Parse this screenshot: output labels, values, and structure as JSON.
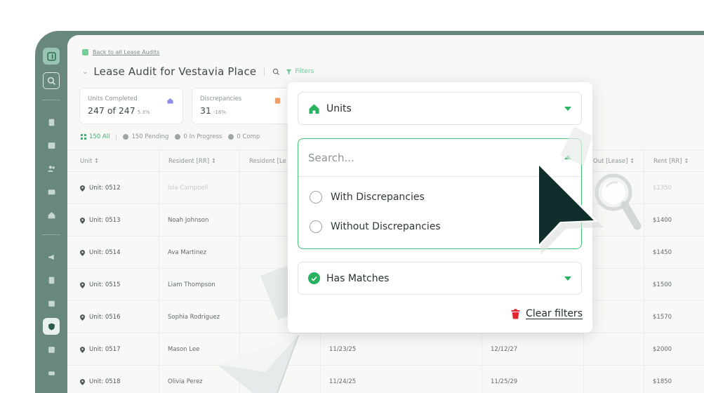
{
  "back_link": "Back to all Lease Audits",
  "page_title": "Lease Audit for Vestavia Place",
  "filters_label": "Filters",
  "stats": [
    {
      "label": "Units Completed",
      "value": "247 of 247",
      "delta": "5.3%"
    },
    {
      "label": "Discrepancies",
      "value": "31",
      "delta": "-18%"
    }
  ],
  "status_tabs": {
    "all": "150 All",
    "pending": "150 Pending",
    "in_progress": "0 In Progress",
    "complete": "0 Comp"
  },
  "table": {
    "columns": [
      "Unit",
      "Resident [RR]",
      "Resident [Le",
      "Out [Lease]",
      "Rent [RR]"
    ],
    "rows": [
      {
        "unit": "Unit: 0512",
        "resident": "Isla Campbell",
        "date1": "",
        "date2": "",
        "rent": "$1350"
      },
      {
        "unit": "Unit: 0513",
        "resident": "Noah Johnson",
        "date1": "",
        "date2": "",
        "rent": "$1400"
      },
      {
        "unit": "Unit: 0514",
        "resident": "Ava Martinez",
        "date1": "",
        "date2": "",
        "rent": "$1450"
      },
      {
        "unit": "Unit: 0515",
        "resident": "Liam Thompson",
        "date1": "",
        "date2": "",
        "rent": "$1500"
      },
      {
        "unit": "Unit: 0516",
        "resident": "Sophia Rodriguez",
        "date1": "",
        "date2": "",
        "rent": "$1570"
      },
      {
        "unit": "Unit: 0517",
        "resident": "Mason Lee",
        "date1": "11/23/25",
        "date2": "12/12/27",
        "rent": "$2000"
      },
      {
        "unit": "Unit: 0518",
        "resident": "Olivia Perez",
        "date1": "11/24/25",
        "date2": "11/25/29",
        "rent": "$1850"
      }
    ]
  },
  "filter_panel": {
    "units_select": "Units",
    "search_placeholder": "Search...",
    "options": [
      "With Discrepancies",
      "Without Discrepancies"
    ],
    "has_matches": "Has Matches",
    "clear_filters": "Clear filters"
  },
  "colors": {
    "sidebar": "#67877f",
    "accent_green": "#26b25f",
    "clear_red": "#e0262c",
    "cursor": "#0f2e2c"
  },
  "icons": {
    "units": "home-icon",
    "has_matches": "check-circle-icon",
    "clear_filters": "trash-icon",
    "search": "search-icon",
    "filters": "funnel-icon",
    "unit_pin": "map-pin-icon"
  }
}
